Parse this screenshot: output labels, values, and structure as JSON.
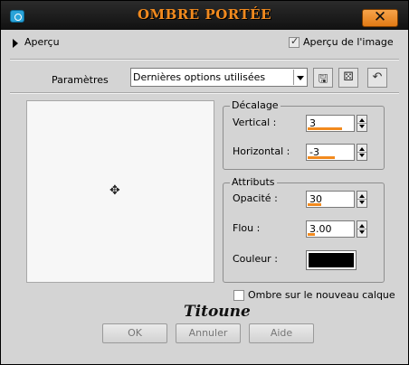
{
  "window": {
    "title": "OMBRE PORTÉE",
    "close_label": "✕"
  },
  "preview": {
    "label": "Aperçu",
    "image_preview_label": "Aperçu de l'image",
    "image_preview_checked": true
  },
  "params": {
    "label": "Paramètres",
    "preset_value": "Dernières options utilisées"
  },
  "offset": {
    "group_label": "Décalage",
    "vertical": {
      "label": "Vertical :",
      "value": "3",
      "fill": 0.75
    },
    "horizontal": {
      "label": "Horizontal :",
      "value": "-3",
      "fill": 0.6
    }
  },
  "attributes": {
    "group_label": "Attributs",
    "opacity": {
      "label": "Opacité :",
      "value": "30",
      "fill": 0.3
    },
    "blur": {
      "label": "Flou :",
      "value": "3.00",
      "fill": 0.15
    },
    "color": {
      "label": "Couleur :",
      "value": "#000000"
    }
  },
  "new_layer": {
    "label": "Ombre sur le nouveau calque",
    "checked": false
  },
  "signature": "Titoune",
  "buttons": {
    "ok": "OK",
    "cancel": "Annuler",
    "help": "Aide"
  }
}
